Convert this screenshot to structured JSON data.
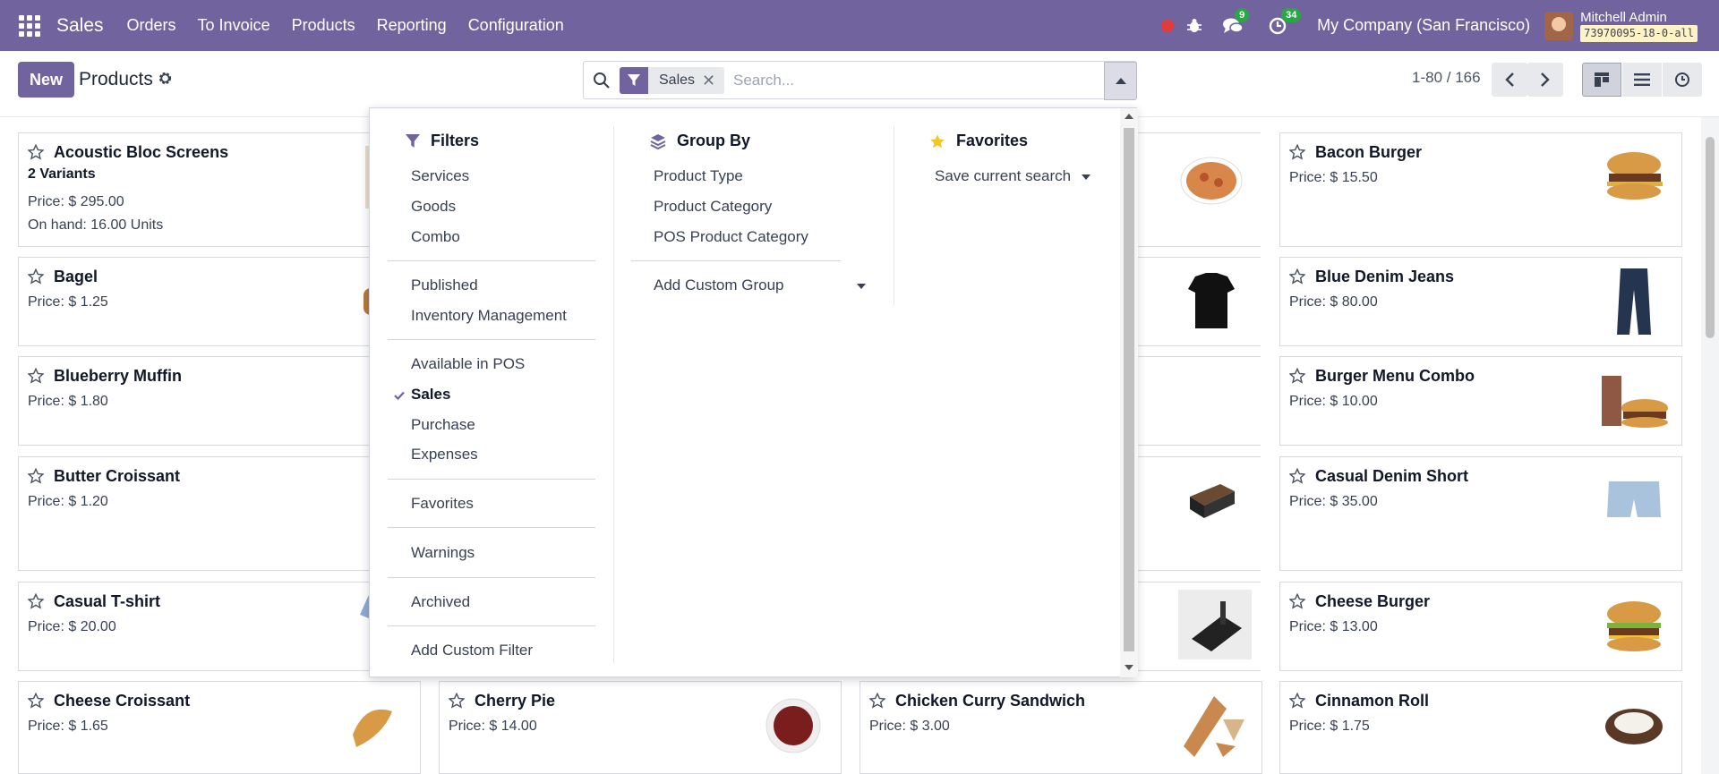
{
  "navbar": {
    "app_name": "Sales",
    "menu": [
      "Orders",
      "To Invoice",
      "Products",
      "Reporting",
      "Configuration"
    ],
    "messages_count": "9",
    "activities_count": "34",
    "company": "My Company (San Francisco)",
    "user_name": "Mitchell Admin",
    "db_name": "73970095-18-0-all",
    "accent_color": "#71639e"
  },
  "control": {
    "new_label": "New",
    "title": "Products",
    "facet_label": "Sales",
    "facet_close": "✕",
    "search_placeholder": "Search...",
    "pager": "1-80 / 166"
  },
  "dropdown": {
    "filters": {
      "title": "Filters",
      "groups": [
        [
          "Services",
          "Goods",
          "Combo"
        ],
        [
          "Published",
          "Inventory Management"
        ],
        [
          "Available in POS",
          "Sales",
          "Purchase",
          "Expenses"
        ],
        [
          "Favorites"
        ],
        [
          "Warnings"
        ],
        [
          "Archived"
        ]
      ],
      "checked": "Sales",
      "add_custom": "Add Custom Filter"
    },
    "group_by": {
      "title": "Group By",
      "items": [
        "Product Type",
        "Product Category",
        "POS Product Category"
      ],
      "add_custom": "Add Custom Group"
    },
    "favorites": {
      "title": "Favorites",
      "save_current": "Save current search"
    }
  },
  "cards": [
    {
      "name": "Acoustic Bloc Screens",
      "variants": "2 Variants",
      "price": "Price: $ 295.00",
      "onhand": "On hand: 16.00 Units"
    },
    {
      "name": "Bacon Burger",
      "price": "Price: $ 15.50"
    },
    {
      "name": "Bagel",
      "price": "Price: $ 1.25"
    },
    {
      "name": "Blue Denim Jeans",
      "price": "Price: $ 80.00"
    },
    {
      "name": "Blueberry Muffin",
      "price": "Price: $ 1.80"
    },
    {
      "name": "Burger Menu Combo",
      "price": "Price: $ 10.00"
    },
    {
      "name": "Butter Croissant",
      "price": "Price: $ 1.20"
    },
    {
      "name": "Casual Denim Short",
      "price": "Price: $ 35.00"
    },
    {
      "name": "Casual T-shirt",
      "price": "Price: $ 20.00"
    },
    {
      "name": "Cheese Burger",
      "price": "Price: $ 13.00"
    },
    {
      "name": "Cheese Croissant",
      "price": "Price: $ 1.65"
    },
    {
      "name": "Cherry Pie",
      "price": "Price: $ 14.00"
    },
    {
      "name": "Chicken Curry Sandwich",
      "price": "Price: $ 3.00"
    },
    {
      "name": "Cinnamon Roll",
      "price": "Price: $ 1.75"
    }
  ]
}
